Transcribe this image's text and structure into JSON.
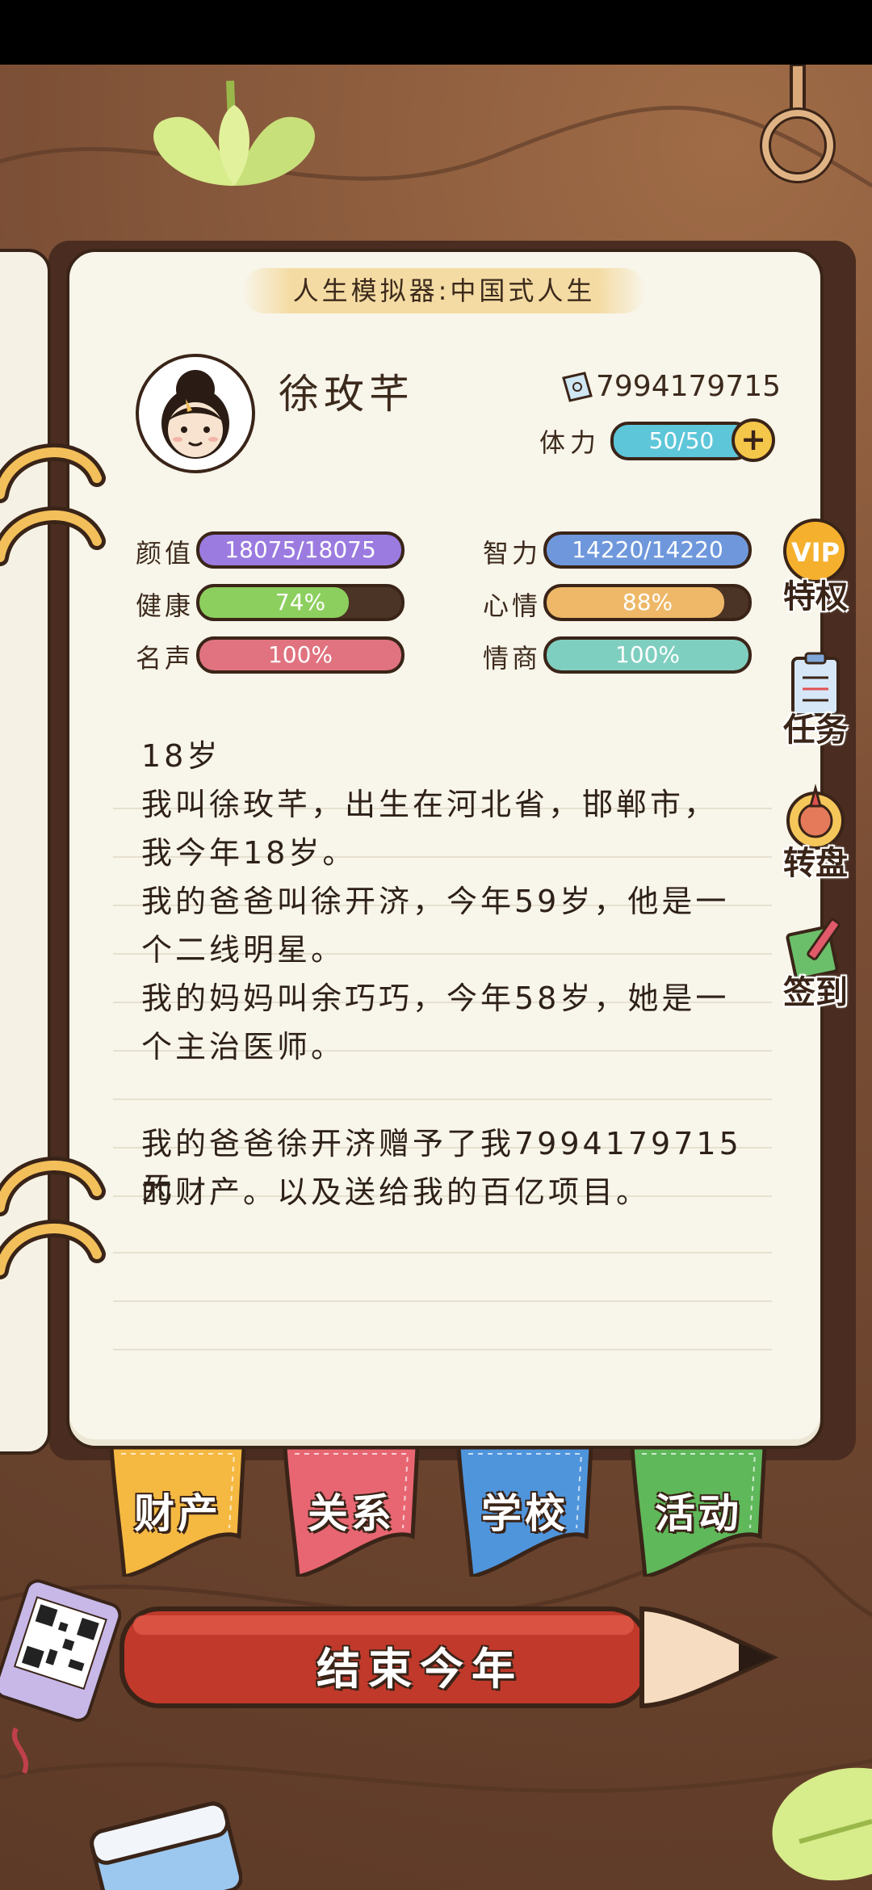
{
  "header": {
    "title": "人生模拟器:中国式人生"
  },
  "profile": {
    "name": "徐玫芊",
    "money": "7994179715",
    "stamina_label": "体力",
    "stamina_value": "50/50",
    "plus_symbol": "+"
  },
  "stats": [
    {
      "label": "颜值",
      "value": "18075/18075",
      "fill": 1.0,
      "color": "#9b7be0"
    },
    {
      "label": "智力",
      "value": "14220/14220",
      "fill": 1.0,
      "color": "#6f98dc"
    },
    {
      "label": "健康",
      "value": "74%",
      "fill": 0.74,
      "color": "#8ccf5e"
    },
    {
      "label": "心情",
      "value": "88%",
      "fill": 0.88,
      "color": "#eeb868"
    },
    {
      "label": "名声",
      "value": "100%",
      "fill": 1.0,
      "color": "#e0737f"
    },
    {
      "label": "情商",
      "value": "100%",
      "fill": 1.0,
      "color": "#7fcfc0"
    }
  ],
  "side_menu": [
    {
      "label": "特权",
      "badge": "VIP",
      "icon": "vip-icon"
    },
    {
      "label": "任务",
      "icon": "clipboard-icon"
    },
    {
      "label": "转盘",
      "icon": "wheel-icon"
    },
    {
      "label": "签到",
      "icon": "checkin-book-icon"
    }
  ],
  "story": {
    "age_line": "18岁",
    "lines": [
      "我叫徐玫芊，出生在河北省，邯郸市，",
      "我今年18岁。",
      "我的爸爸叫徐开济，今年59岁，他是一",
      "个二线明星。",
      "我的妈妈叫余巧巧，今年58岁，她是一",
      "个主治医师。",
      "",
      "我的爸爸徐开济赠予了我7994179715元",
      "的财产。以及送给我的百亿项目。"
    ]
  },
  "tabs": [
    {
      "label": "财产",
      "color": "#f5b942"
    },
    {
      "label": "关系",
      "color": "#e86672"
    },
    {
      "label": "学校",
      "color": "#4f95dc"
    },
    {
      "label": "活动",
      "color": "#5fb85a"
    }
  ],
  "end_year_button": {
    "label": "结束今年"
  }
}
